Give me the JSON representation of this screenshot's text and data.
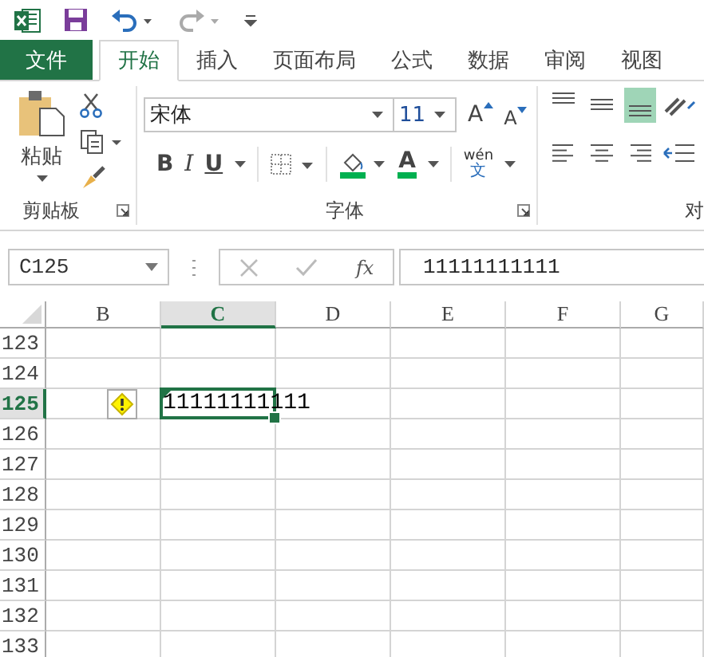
{
  "tabs": [
    {
      "label": "文件",
      "kind": "file",
      "selected": false
    },
    {
      "label": "开始",
      "kind": "tab",
      "selected": true
    },
    {
      "label": "插入",
      "kind": "tab",
      "selected": false
    },
    {
      "label": "页面布局",
      "kind": "tab",
      "selected": false
    },
    {
      "label": "公式",
      "kind": "tab",
      "selected": false
    },
    {
      "label": "数据",
      "kind": "tab",
      "selected": false
    },
    {
      "label": "审阅",
      "kind": "tab",
      "selected": false
    },
    {
      "label": "视图",
      "kind": "tab",
      "selected": false
    }
  ],
  "ribbon": {
    "clipboard": {
      "paste_label": "粘贴",
      "title": "剪贴板"
    },
    "font": {
      "font_name": "宋体",
      "font_size": "11",
      "grow_label": "A",
      "shrink_label": "A",
      "bold": "B",
      "italic": "I",
      "underline": "U",
      "font_color_label": "A",
      "phonetic_pinyin": "wén",
      "phonetic_char": "文",
      "title": "字体"
    },
    "alignment": {
      "vertical": [
        {
          "kind": "top",
          "selected": false
        },
        {
          "kind": "middle",
          "selected": false
        },
        {
          "kind": "bottom",
          "selected": true
        }
      ],
      "horizontal": [
        {
          "kind": "left",
          "selected": false
        },
        {
          "kind": "center",
          "selected": false
        },
        {
          "kind": "right",
          "selected": false
        }
      ],
      "title": "对"
    }
  },
  "formula_bar": {
    "name_box": "C125",
    "function_label": "fx",
    "value": "11111111111"
  },
  "sheet": {
    "columns": [
      {
        "label": "B",
        "selected": false
      },
      {
        "label": "C",
        "selected": true
      },
      {
        "label": "D",
        "selected": false
      },
      {
        "label": "E",
        "selected": false
      },
      {
        "label": "F",
        "selected": false
      },
      {
        "label": "G",
        "selected": false
      }
    ],
    "rows": [
      {
        "label": "123",
        "selected": false
      },
      {
        "label": "124",
        "selected": false
      },
      {
        "label": "125",
        "selected": true
      },
      {
        "label": "126",
        "selected": false
      },
      {
        "label": "127",
        "selected": false
      },
      {
        "label": "128",
        "selected": false
      },
      {
        "label": "129",
        "selected": false
      },
      {
        "label": "130",
        "selected": false
      },
      {
        "label": "131",
        "selected": false
      },
      {
        "label": "132",
        "selected": false
      },
      {
        "label": "133",
        "selected": false
      }
    ],
    "active_cell": {
      "value": "11111111111",
      "error_indicator": true,
      "smart_tag": true
    }
  }
}
